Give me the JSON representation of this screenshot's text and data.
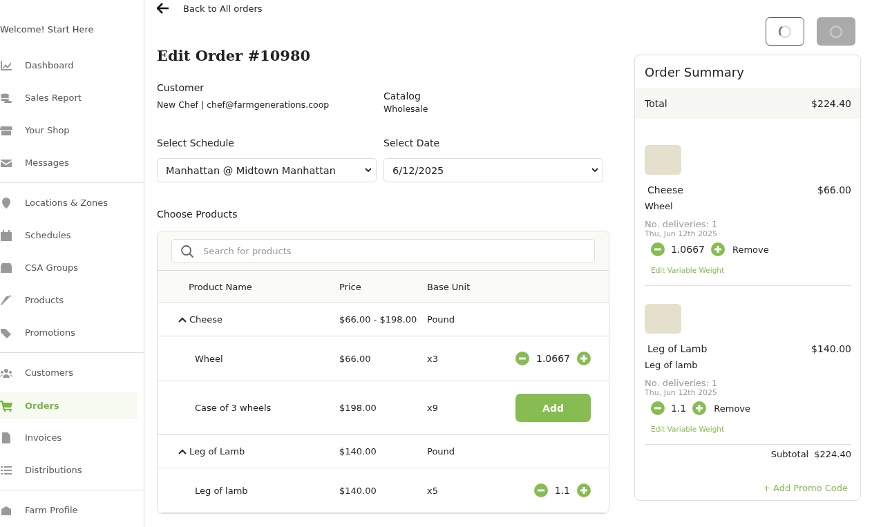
{
  "sidebar": {
    "welcome": "Welcome! Start Here",
    "groups": [
      [
        {
          "label": "Dashboard",
          "selected": false
        },
        {
          "label": "Sales Report",
          "selected": false
        },
        {
          "label": "Your Shop",
          "selected": false
        },
        {
          "label": "Messages",
          "selected": false
        }
      ],
      [
        {
          "label": "Locations & Zones",
          "selected": false
        },
        {
          "label": "Schedules",
          "selected": false
        },
        {
          "label": "CSA Groups",
          "selected": false
        },
        {
          "label": "Products",
          "selected": false
        },
        {
          "label": "Promotions",
          "selected": false
        }
      ],
      [
        {
          "label": "Customers",
          "selected": false
        },
        {
          "label": "Orders",
          "selected": true
        },
        {
          "label": "Invoices",
          "selected": false
        },
        {
          "label": "Distributions",
          "selected": false
        }
      ],
      [
        {
          "label": "Farm Profile",
          "selected": false
        }
      ]
    ]
  },
  "back_link": "Back to All orders",
  "title": "Edit Order #10980",
  "customer": {
    "label": "Customer",
    "value": "New Chef | chef@farmgenerations.coop"
  },
  "catalog": {
    "label": "Catalog",
    "value": "Wholesale"
  },
  "schedule": {
    "label": "Select Schedule",
    "value": "Manhattan @ Midtown Manhattan"
  },
  "date": {
    "label": "Select Date",
    "value": "6/12/2025"
  },
  "products": {
    "label": "Choose Products",
    "search_placeholder": "Search for products",
    "columns": [
      "Product Name",
      "Price",
      "Base Unit"
    ],
    "rows": [
      {
        "name": "Cheese",
        "price": "$66.00 - $198.00",
        "unit": "Pound",
        "expanded": true,
        "children": [
          {
            "kind": "stepper",
            "name": "Wheel",
            "price": "$66.00",
            "unit": "x3",
            "quantity": "1.0667"
          },
          {
            "kind": "add",
            "name": "Case of 3 wheels",
            "price": "$198.00",
            "unit": "x9",
            "button": "Add"
          }
        ]
      },
      {
        "name": "Leg of Lamb",
        "price": "$140.00",
        "unit": "Pound",
        "expanded": true,
        "children": [
          {
            "kind": "stepper",
            "name": "Leg of lamb",
            "price": "$140.00",
            "unit": "x5",
            "quantity": "1.1"
          }
        ]
      }
    ]
  },
  "summary": {
    "title": "Order Summary",
    "total_label": "Total",
    "total": "$224.40",
    "items": [
      {
        "name": "Cheese",
        "price": "$66.00",
        "variant": "Wheel",
        "deliveries": "No. deliveries: 1",
        "date": "Thu, Jun 12th 2025",
        "quantity": "1.0667",
        "remove": "Remove",
        "edit": "Edit Variable Weight"
      },
      {
        "name": "Leg of Lamb",
        "price": "$140.00",
        "variant": "Leg of lamb",
        "deliveries": "No. deliveries: 1",
        "date": "Thu, Jun 12th 2025",
        "quantity": "1.1",
        "remove": "Remove",
        "edit": "Edit Variable Weight"
      }
    ],
    "subtotal_label": "Subtotal",
    "subtotal": "$224.40",
    "promo": "+ Add Promo Code"
  }
}
